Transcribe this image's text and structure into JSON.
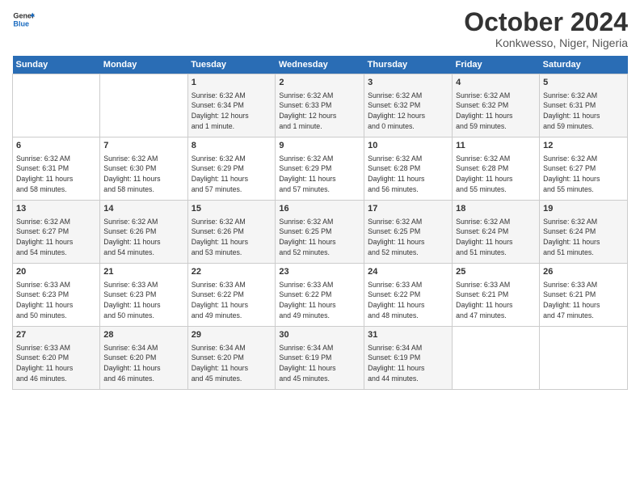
{
  "header": {
    "logo_line1": "General",
    "logo_line2": "Blue",
    "month": "October 2024",
    "location": "Konkwesso, Niger, Nigeria"
  },
  "days_of_week": [
    "Sunday",
    "Monday",
    "Tuesday",
    "Wednesday",
    "Thursday",
    "Friday",
    "Saturday"
  ],
  "weeks": [
    [
      {
        "day": "",
        "info": ""
      },
      {
        "day": "",
        "info": ""
      },
      {
        "day": "1",
        "info": "Sunrise: 6:32 AM\nSunset: 6:34 PM\nDaylight: 12 hours\nand 1 minute."
      },
      {
        "day": "2",
        "info": "Sunrise: 6:32 AM\nSunset: 6:33 PM\nDaylight: 12 hours\nand 1 minute."
      },
      {
        "day": "3",
        "info": "Sunrise: 6:32 AM\nSunset: 6:32 PM\nDaylight: 12 hours\nand 0 minutes."
      },
      {
        "day": "4",
        "info": "Sunrise: 6:32 AM\nSunset: 6:32 PM\nDaylight: 11 hours\nand 59 minutes."
      },
      {
        "day": "5",
        "info": "Sunrise: 6:32 AM\nSunset: 6:31 PM\nDaylight: 11 hours\nand 59 minutes."
      }
    ],
    [
      {
        "day": "6",
        "info": "Sunrise: 6:32 AM\nSunset: 6:31 PM\nDaylight: 11 hours\nand 58 minutes."
      },
      {
        "day": "7",
        "info": "Sunrise: 6:32 AM\nSunset: 6:30 PM\nDaylight: 11 hours\nand 58 minutes."
      },
      {
        "day": "8",
        "info": "Sunrise: 6:32 AM\nSunset: 6:29 PM\nDaylight: 11 hours\nand 57 minutes."
      },
      {
        "day": "9",
        "info": "Sunrise: 6:32 AM\nSunset: 6:29 PM\nDaylight: 11 hours\nand 57 minutes."
      },
      {
        "day": "10",
        "info": "Sunrise: 6:32 AM\nSunset: 6:28 PM\nDaylight: 11 hours\nand 56 minutes."
      },
      {
        "day": "11",
        "info": "Sunrise: 6:32 AM\nSunset: 6:28 PM\nDaylight: 11 hours\nand 55 minutes."
      },
      {
        "day": "12",
        "info": "Sunrise: 6:32 AM\nSunset: 6:27 PM\nDaylight: 11 hours\nand 55 minutes."
      }
    ],
    [
      {
        "day": "13",
        "info": "Sunrise: 6:32 AM\nSunset: 6:27 PM\nDaylight: 11 hours\nand 54 minutes."
      },
      {
        "day": "14",
        "info": "Sunrise: 6:32 AM\nSunset: 6:26 PM\nDaylight: 11 hours\nand 54 minutes."
      },
      {
        "day": "15",
        "info": "Sunrise: 6:32 AM\nSunset: 6:26 PM\nDaylight: 11 hours\nand 53 minutes."
      },
      {
        "day": "16",
        "info": "Sunrise: 6:32 AM\nSunset: 6:25 PM\nDaylight: 11 hours\nand 52 minutes."
      },
      {
        "day": "17",
        "info": "Sunrise: 6:32 AM\nSunset: 6:25 PM\nDaylight: 11 hours\nand 52 minutes."
      },
      {
        "day": "18",
        "info": "Sunrise: 6:32 AM\nSunset: 6:24 PM\nDaylight: 11 hours\nand 51 minutes."
      },
      {
        "day": "19",
        "info": "Sunrise: 6:32 AM\nSunset: 6:24 PM\nDaylight: 11 hours\nand 51 minutes."
      }
    ],
    [
      {
        "day": "20",
        "info": "Sunrise: 6:33 AM\nSunset: 6:23 PM\nDaylight: 11 hours\nand 50 minutes."
      },
      {
        "day": "21",
        "info": "Sunrise: 6:33 AM\nSunset: 6:23 PM\nDaylight: 11 hours\nand 50 minutes."
      },
      {
        "day": "22",
        "info": "Sunrise: 6:33 AM\nSunset: 6:22 PM\nDaylight: 11 hours\nand 49 minutes."
      },
      {
        "day": "23",
        "info": "Sunrise: 6:33 AM\nSunset: 6:22 PM\nDaylight: 11 hours\nand 49 minutes."
      },
      {
        "day": "24",
        "info": "Sunrise: 6:33 AM\nSunset: 6:22 PM\nDaylight: 11 hours\nand 48 minutes."
      },
      {
        "day": "25",
        "info": "Sunrise: 6:33 AM\nSunset: 6:21 PM\nDaylight: 11 hours\nand 47 minutes."
      },
      {
        "day": "26",
        "info": "Sunrise: 6:33 AM\nSunset: 6:21 PM\nDaylight: 11 hours\nand 47 minutes."
      }
    ],
    [
      {
        "day": "27",
        "info": "Sunrise: 6:33 AM\nSunset: 6:20 PM\nDaylight: 11 hours\nand 46 minutes."
      },
      {
        "day": "28",
        "info": "Sunrise: 6:34 AM\nSunset: 6:20 PM\nDaylight: 11 hours\nand 46 minutes."
      },
      {
        "day": "29",
        "info": "Sunrise: 6:34 AM\nSunset: 6:20 PM\nDaylight: 11 hours\nand 45 minutes."
      },
      {
        "day": "30",
        "info": "Sunrise: 6:34 AM\nSunset: 6:19 PM\nDaylight: 11 hours\nand 45 minutes."
      },
      {
        "day": "31",
        "info": "Sunrise: 6:34 AM\nSunset: 6:19 PM\nDaylight: 11 hours\nand 44 minutes."
      },
      {
        "day": "",
        "info": ""
      },
      {
        "day": "",
        "info": ""
      }
    ]
  ]
}
